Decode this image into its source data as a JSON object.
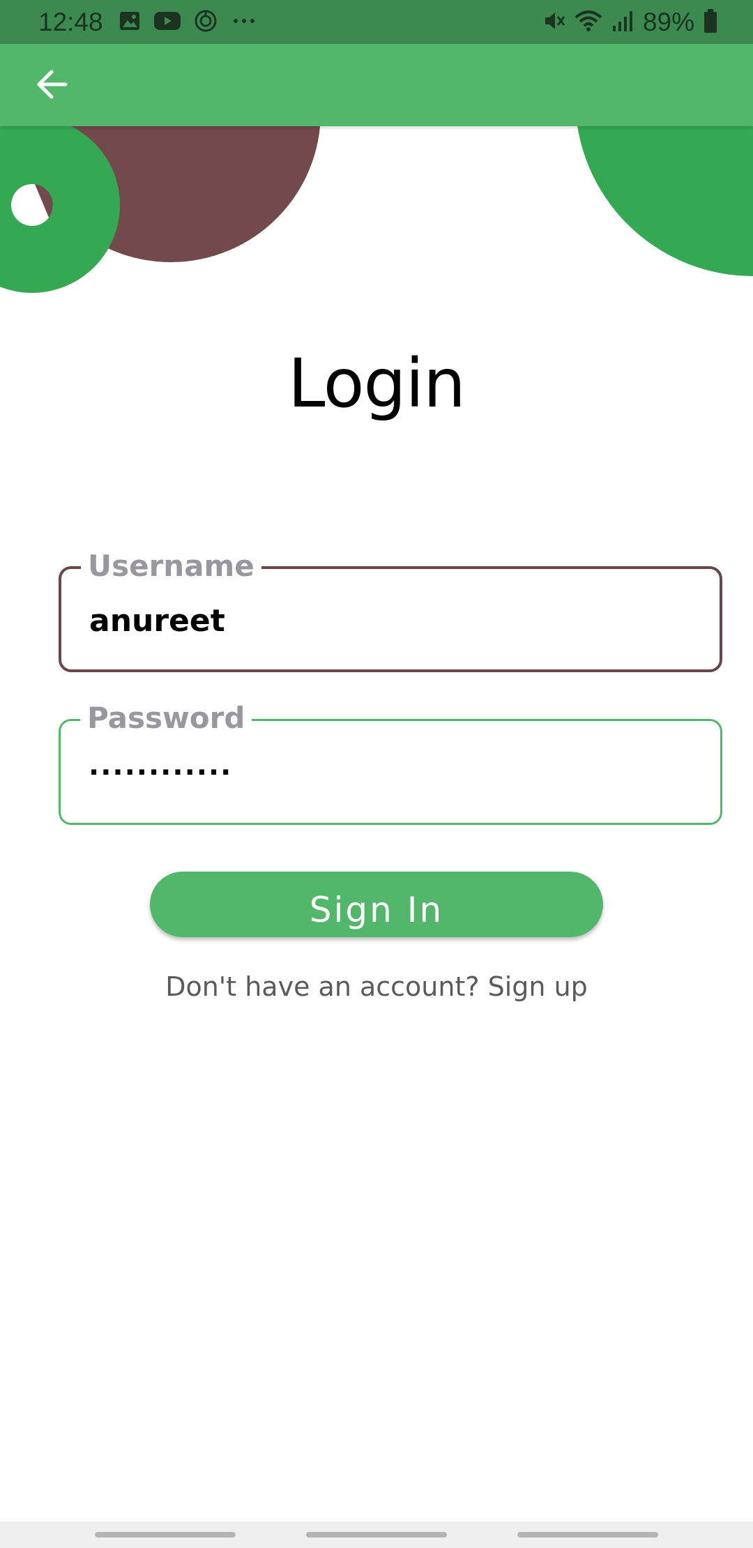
{
  "status_bar": {
    "time": "12:48",
    "battery": "89%",
    "left_icons": [
      "image-icon",
      "youtube-icon",
      "sync-icon",
      "more-dots-icon"
    ],
    "right_icons": [
      "mute-icon",
      "wifi-icon",
      "signal-icon",
      "battery-icon"
    ]
  },
  "app_bar": {
    "back_icon": "arrow-left-icon"
  },
  "page": {
    "title": "Login"
  },
  "form": {
    "username": {
      "label": "Username",
      "value": "anureet"
    },
    "password": {
      "label": "Password",
      "value": "············"
    },
    "submit_label": "Sign In",
    "signup_prompt": "Don't have an account? Sign up"
  },
  "colors": {
    "primary_green": "#52b76a",
    "dark_green": "#34a853",
    "brown": "#6b4547",
    "label_gray": "#9a96a0"
  }
}
